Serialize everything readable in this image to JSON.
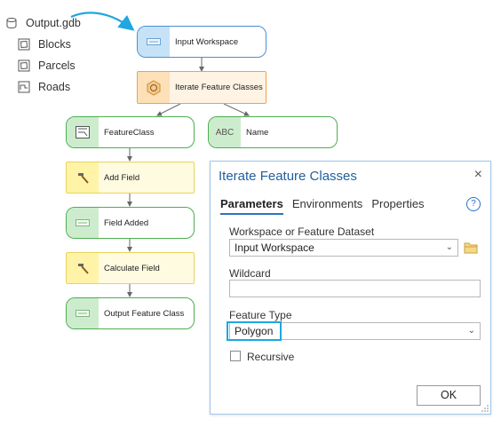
{
  "catalog": {
    "root": "Output.gdb",
    "items": [
      "Blocks",
      "Parcels",
      "Roads"
    ]
  },
  "model": {
    "input_workspace": "Input Workspace",
    "iterate_tool": "Iterate Feature Classes",
    "feature_class": "FeatureClass",
    "name": "Name",
    "name_icon_text": "ABC",
    "add_field": "Add Field",
    "field_added": "Field Added",
    "calculate_field": "Calculate Field",
    "output_feature_class": "Output Feature Class"
  },
  "dialog": {
    "title": "Iterate Feature Classes",
    "close": "×",
    "tabs": [
      "Parameters",
      "Environments",
      "Properties"
    ],
    "help": "?",
    "workspace_label": "Workspace or Feature Dataset",
    "workspace_value": "Input Workspace",
    "wildcard_label": "Wildcard",
    "wildcard_value": "",
    "feature_type_label": "Feature Type",
    "feature_type_value": "Polygon",
    "recursive_label": "Recursive",
    "ok": "OK"
  },
  "colors": {
    "highlight": "#1ea7e1",
    "accent": "#2a72c6",
    "dialog_title": "#1f5f9e"
  }
}
